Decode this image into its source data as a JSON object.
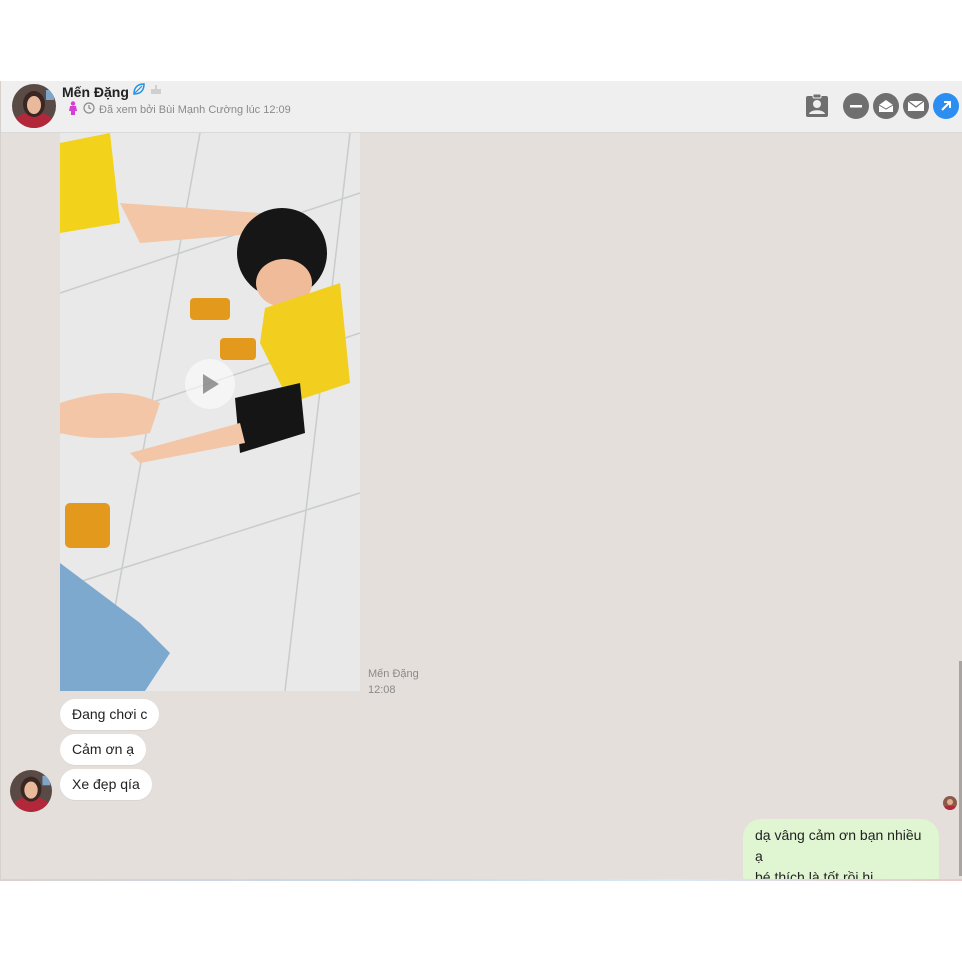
{
  "header": {
    "contact_name": "Mến Đặng",
    "seen_text": "Đã xem bởi Bùi Mạnh Cường lúc 12:09",
    "icons": [
      "leaf-verified-icon",
      "cake-icon",
      "female-icon",
      "clock-icon",
      "contact-card-icon",
      "minimize-icon",
      "open-envelope-icon",
      "mail-icon",
      "expand-arrow-icon"
    ]
  },
  "video_message": {
    "sender": "Mến Đặng",
    "time": "12:08",
    "icon": "play-icon"
  },
  "incoming_messages": [
    {
      "text": "Đang chơi c"
    },
    {
      "text": "Cảm ơn ạ"
    },
    {
      "text": "Xe đẹp qía"
    }
  ],
  "outgoing_message": {
    "line1": "dạ vâng cảm ơn bạn nhiều ạ",
    "line2": "bé thích là tốt rồi hi"
  },
  "colors": {
    "chat_background": "#e5dfdb",
    "header_background": "#efefef",
    "outgoing_bubble": "#e0f5d2",
    "incoming_bubble": "#ffffff",
    "accent_blue": "#2b8ef0",
    "icon_gray": "#6f6f6f"
  }
}
